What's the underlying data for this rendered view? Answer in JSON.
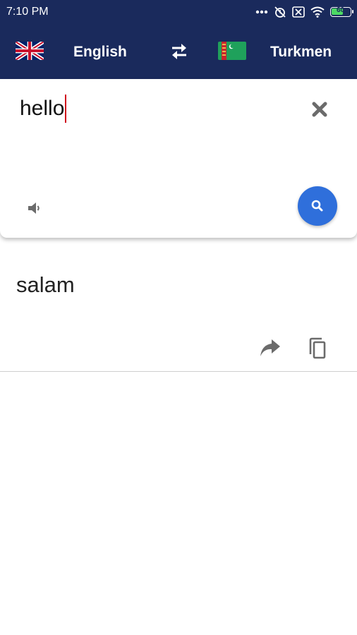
{
  "status_bar": {
    "time": "7:10 PM",
    "battery_level": "60"
  },
  "language_bar": {
    "source_language": "English",
    "target_language": "Turkmen",
    "source_flag_icon": "uk-flag-icon",
    "target_flag_icon": "turkmenistan-flag-icon",
    "swap_icon": "swap-arrows-icon"
  },
  "input": {
    "text": "hello",
    "clear_icon": "close-icon",
    "speaker_icon": "speaker-icon",
    "search_icon": "search-icon"
  },
  "result": {
    "text": "salam",
    "share_icon": "share-icon",
    "copy_icon": "copy-icon"
  },
  "colors": {
    "header_bg": "#1a2a5c",
    "accent": "#2f6fdb",
    "caret": "#d0021b"
  }
}
